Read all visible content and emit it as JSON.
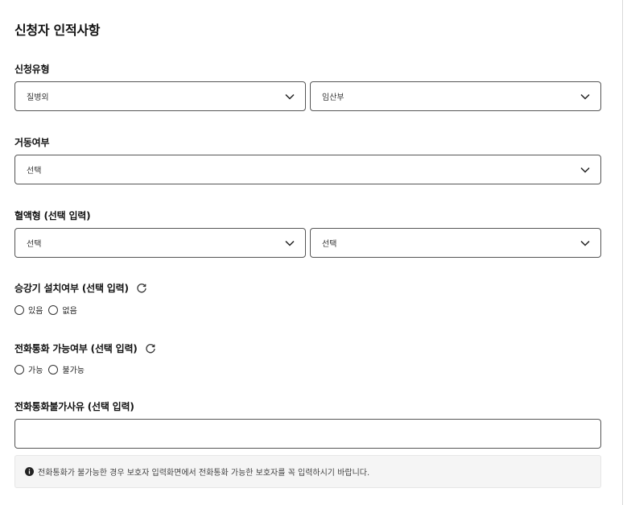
{
  "section_title": "신청자 인적사항",
  "fields": {
    "application_type": {
      "label": "신청유형",
      "select_1_value": "질병외",
      "select_2_value": "임산부"
    },
    "mobility": {
      "label": "거동여부",
      "select_value": "선택"
    },
    "blood_type": {
      "label": "혈액형 (선택 입력)",
      "select_1_value": "선택",
      "select_2_value": "선택"
    },
    "lift_installed": {
      "label": "승강기 설치여부 (선택 입력)",
      "options": [
        "있음",
        "없음"
      ]
    },
    "phone_call": {
      "label": "전화통화 가능여부 (선택 입력)",
      "options": [
        "가능",
        "불가능"
      ]
    },
    "phone_unavailable_reason": {
      "label": "전화통화불가사유 (선택 입력)",
      "value": "",
      "placeholder": ""
    }
  },
  "info_note": "전화통화가 불가능한 경우 보호자 입력화면에서 전화통화 가능한 보호자를 꼭 입력하시기 바랍니다.",
  "icons": {
    "dropdown": "chevron-down-icon",
    "reset": "refresh-icon",
    "info": "info-circle-icon"
  },
  "colors": {
    "border": "#555555",
    "info_bg": "#f5f5f5",
    "text": "#111111"
  }
}
